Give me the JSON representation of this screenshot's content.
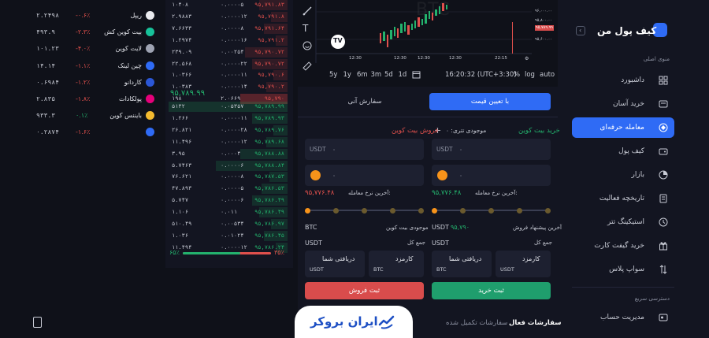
{
  "colors": {
    "accent": "#2f6bf5",
    "buy": "#1f9e6d",
    "sell": "#d94c4c",
    "up": "#23b26d",
    "down": "#e0504c"
  },
  "sidebar": {
    "brand": "کیف پول من",
    "menu_title": "منوی اصلی",
    "items": [
      {
        "label": "داشبورد",
        "icon": "grid-icon"
      },
      {
        "label": "خرید آسان",
        "icon": "cart-icon"
      },
      {
        "label": "معامله حرفه‌ای",
        "icon": "trade-icon",
        "active": true
      },
      {
        "label": "کیف پول",
        "icon": "wallet-icon"
      },
      {
        "label": "بازار",
        "icon": "market-icon"
      },
      {
        "label": "تاریخچه فعالیت",
        "icon": "history-icon"
      },
      {
        "label": "استیکینگ تتر",
        "icon": "staking-icon"
      },
      {
        "label": "خرید گیفت کارت",
        "icon": "gift-icon"
      },
      {
        "label": "سواپ پلاس",
        "icon": "swap-icon"
      }
    ],
    "quick_title": "دسترسی سریع",
    "quick_items": [
      {
        "label": "مدیریت حساب",
        "icon": "account-icon"
      }
    ]
  },
  "assets": [
    {
      "name": "ریپل",
      "change": "-۰.۶٪",
      "price": "۲.۲۴۹۸",
      "dir": "down"
    },
    {
      "name": "بیت کوین کش",
      "change": "-۲.۳٪",
      "price": "۴۹۳.۹",
      "dir": "down"
    },
    {
      "name": "لایت کوین",
      "change": "-۴.۰٪",
      "price": "۱۰۱.۲۳",
      "dir": "down"
    },
    {
      "name": "چین لینک",
      "change": "-۱.۱٪",
      "price": "۱۴.۱۴",
      "dir": "down"
    },
    {
      "name": "کاردانو",
      "change": "-۱.۲٪",
      "price": "۰.۶۹۸۴",
      "dir": "down"
    },
    {
      "name": "پولکادات",
      "change": "-۱.۸٪",
      "price": "۲.۸۳۵",
      "dir": "down"
    },
    {
      "name": "بایننس کوین",
      "change": "۰.۱٪",
      "price": "۹۳۳.۳",
      "dir": "up"
    },
    {
      "name": "",
      "change": "-۱.۶٪",
      "price": "۰.۲۸۷۴",
      "dir": "down"
    }
  ],
  "orderbook": {
    "asks": [
      [
        "۱۰۴۰۸",
        "۰.۰۰۰۰۵",
        "۹۵,۷۹۱.۸۳"
      ],
      [
        "۲.۹۸۸۳",
        "۰.۰۰۰۰۱۲",
        "۹۵,۷۹۱.۸"
      ],
      [
        "۷.۶۶۳۳",
        "۰.۰۰۰۰۸",
        "۹۵,۷۹۱.۶۴"
      ],
      [
        "۱.۲۹۷۴",
        "۰.۰۰۰۰۱۶",
        "۹۵,۷۹۱.۲"
      ],
      [
        "۲۳۹.۰۹",
        "۰.۰۰۲۵۴",
        "۹۵,۷۹۰.۷۲"
      ],
      [
        "۲۲.۵۶۸",
        "۰.۰۰۰۰۲۲",
        "۹۵,۷۹۰.۷۲"
      ],
      [
        "۱.۰۳۶۶",
        "۰.۰۰۰۰۱۱",
        "۹۵,۷۹۰.۶"
      ],
      [
        "۱.۰۳۸۳",
        "۰.۰۰۰۰۱۴",
        "۹۵,۷۹۰.۲"
      ],
      [
        "۱۹۸",
        "۲.۰۶۶۹",
        "۹۵,۷۹۰"
      ]
    ],
    "mid": "۹۵,۷۸۹.۹۹",
    "bids": [
      [
        "۵۱۳۲",
        "۰.۰۵۳۵۷",
        "۹۵,۷۸۹.۹۹"
      ],
      [
        "۱.۲۶۶",
        "۰.۰۰۰۰۱۱",
        "۹۵,۷۸۹.۹۳"
      ],
      [
        "۲۶.۸۲۱",
        "۰.۰۰۰۰۲۸",
        "۹۵,۷۸۹.۷۶"
      ],
      [
        "۱۱.۴۹۶",
        "۰.۰۰۰۰۱۲",
        "۹۵,۷۸۹.۶۸"
      ],
      [
        "۳.۹۵",
        "۰.۰۰۰۴",
        "۹۵,۷۸۸.۸۸"
      ],
      [
        "۵.۷۴۶۳",
        "۰.۰۰۰۰۶",
        "۹۵,۷۸۸.۸۴"
      ],
      [
        "۷۶.۶۲۱",
        "۰.۰۰۰۰۸",
        "۹۵,۷۸۷.۵۳"
      ],
      [
        "۴۷.۸۹۳",
        "۰.۰۰۰۰۵",
        "۹۵,۷۸۶.۵۳"
      ],
      [
        "۵.۷۴۷",
        "۰.۰۰۰۰۶",
        "۹۵,۷۸۶.۴۹"
      ],
      [
        "۱.۱۰۶",
        "۰.۰۱۱",
        "۹۵,۷۸۶.۴۹"
      ],
      [
        "۵۱۰.۴۹",
        "۰.۰۰۵۳۴",
        "۹۵,۷۸۶.۹۷"
      ],
      [
        "۱.۰۳۶",
        "۰.۰۱۰۲۴",
        "۹۵,۷۸۶.۴۵"
      ],
      [
        "۱۱.۴۹۴",
        "۰.۰۰۰۰۱۲",
        "۹۵,۷۸۶.۲۴"
      ]
    ],
    "buy_pct": "۶۵٪",
    "sell_pct": "۳۵٪",
    "buy_ratio": 0.65
  },
  "chart": {
    "watermark": "BTC",
    "price_labels": [
      "۹۶,۰۰۰.۰۰",
      "۹۵,۸۰۰.۰۰",
      "۹۵,۷۸۹.۹۹",
      "۹۵,۶۰۰.۰۰"
    ],
    "time_labels": [
      "12:30",
      "12:30",
      "12:30",
      "12:30",
      "22:15"
    ],
    "ranges": [
      "5y",
      "1y",
      "6m",
      "3m",
      "5d",
      "1d"
    ],
    "clock": "16:20:32 (UTC+3:30)",
    "percent": "%",
    "log": "log",
    "auto": "auto"
  },
  "form": {
    "tab_limit": "با تعیین قیمت",
    "tab_market": "سفارش آنی",
    "buy": {
      "title": "خرید بیت کوین",
      "balance": "موجودی تتری: ۰",
      "price_unit": "USDT",
      "amount_unit": "",
      "last": "آخرین نرخ معامله:",
      "last_price": "۹۵,۷۷۶.۴۸",
      "best": "آخرین پیشنهاد فروش",
      "best_price": "۹۵,۷۹۰",
      "best_unit": "USDT",
      "total_label": "جمع کل",
      "total_unit": "USDT",
      "fee_label": "کارمزد",
      "fee_unit": "USDT",
      "receive_label": "دریافتی شما",
      "receive_unit": "BTC",
      "dot": "۰",
      "button": "ثبت خرید"
    },
    "sell": {
      "title": "فروش بیت کوین",
      "balance": "",
      "price_unit": "USDT",
      "last": "آخرین نرخ معامله:",
      "last_price": "۹۵,۷۷۶.۴۸",
      "best": "موجودی بیت کوین",
      "best_price": "",
      "best_unit": "BTC",
      "total_label": "جمع کل",
      "total_unit": "USDT",
      "fee_label": "کارمزد",
      "fee_unit": "BTC",
      "receive_label": "دریافتی شما",
      "receive_unit": "USDT",
      "dot": "۰",
      "button": "ثبت فروش"
    }
  },
  "orders": {
    "open": "سفارشات فعال",
    "done": "سفارشات تکمیل شده"
  },
  "watermark_brand": "ایران بروکر"
}
